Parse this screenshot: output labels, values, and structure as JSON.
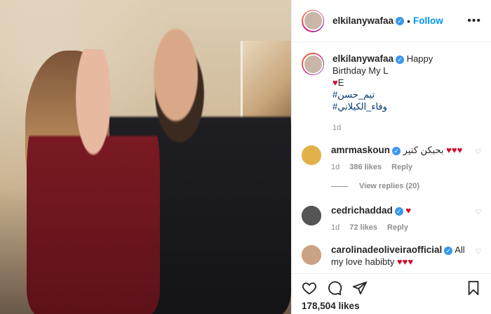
{
  "post": {
    "image_alt": "couple photo"
  },
  "header": {
    "username": "elkilanywafaa",
    "separator": "•",
    "follow_label": "Follow",
    "more_label": "•••"
  },
  "caption": {
    "username": "elkilanywafaa",
    "text": "Happy Birthday My L",
    "text_cont": "E",
    "heart": "♥",
    "hashtag_1": "#تيم_حسن",
    "hashtag_2": "#وفاء_الكيلاني",
    "time": "1d"
  },
  "comments": [
    {
      "username": "amrmaskoun",
      "verified": true,
      "text": "بحبكن كتير",
      "hearts": "♥♥♥",
      "time": "1d",
      "likes": "386 likes",
      "reply": "Reply",
      "view_replies": "View replies (20)"
    },
    {
      "username": "cedrichaddad",
      "verified": true,
      "text": "",
      "hearts": "♥",
      "time": "1d",
      "likes": "72 likes",
      "reply": "Reply"
    },
    {
      "username": "carolinadeoliveiraofficial",
      "verified": true,
      "text": "All my love habibty",
      "hearts": "♥♥♥"
    }
  ],
  "actions": {
    "likes_count": "178,504 likes"
  },
  "colors": {
    "accent": "#0095f6",
    "verified": "#3897f0",
    "heart": "#d10a2b",
    "muted": "#8e8e8e"
  },
  "icons": [
    "heart-icon",
    "comment-icon",
    "share-icon",
    "bookmark-icon",
    "verified-badge-icon",
    "comment-like-icon"
  ]
}
